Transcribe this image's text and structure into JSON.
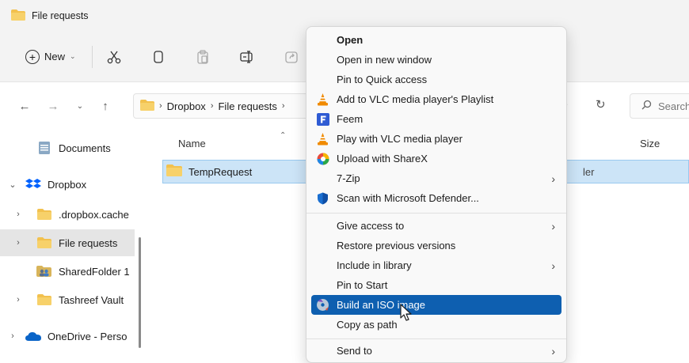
{
  "window": {
    "title": "File requests",
    "folder_icon": "folder-icon"
  },
  "toolbar": {
    "new_label": "New",
    "icons": [
      "cut-icon",
      "copy-icon",
      "paste-icon",
      "rename-icon",
      "share-icon"
    ]
  },
  "address": {
    "segments": [
      "Dropbox",
      "File requests"
    ],
    "search_placeholder": "Search"
  },
  "sidebar": {
    "items": [
      {
        "label": "Documents",
        "icon": "documents-icon"
      },
      {
        "label": "Dropbox",
        "icon": "dropbox-icon"
      },
      {
        "label": ".dropbox.cache",
        "icon": "folder-icon"
      },
      {
        "label": "File requests",
        "icon": "folder-icon"
      },
      {
        "label": "SharedFolder 1",
        "icon": "shared-folder-icon"
      },
      {
        "label": "Tashreef Vault",
        "icon": "folder-icon"
      },
      {
        "label": "OneDrive - Perso",
        "icon": "onedrive-icon"
      }
    ]
  },
  "content": {
    "columns": {
      "name": "Name",
      "size": "Size"
    },
    "rows": [
      {
        "name": "TempRequest",
        "type": "ler"
      }
    ]
  },
  "context_menu": {
    "items": [
      {
        "label": "Open"
      },
      {
        "label": "Open in new window"
      },
      {
        "label": "Pin to Quick access"
      },
      {
        "label": "Add to VLC media player's Playlist",
        "icon": "vlc-icon"
      },
      {
        "label": "Feem",
        "icon": "feem-icon"
      },
      {
        "label": "Play with VLC media player",
        "icon": "vlc-icon"
      },
      {
        "label": "Upload with ShareX",
        "icon": "sharex-icon"
      },
      {
        "label": "7-Zip"
      },
      {
        "label": "Scan with Microsoft Defender...",
        "icon": "defender-icon"
      },
      {
        "label": "Give access to"
      },
      {
        "label": "Restore previous versions"
      },
      {
        "label": "Include in library"
      },
      {
        "label": "Pin to Start"
      },
      {
        "label": "Build an ISO image",
        "icon": "iso-icon"
      },
      {
        "label": "Copy as path"
      },
      {
        "label": "Send to"
      }
    ]
  },
  "colors": {
    "accent": "#0e5fb0",
    "selection": "#cce4f7",
    "folder": "#f2c14e"
  }
}
